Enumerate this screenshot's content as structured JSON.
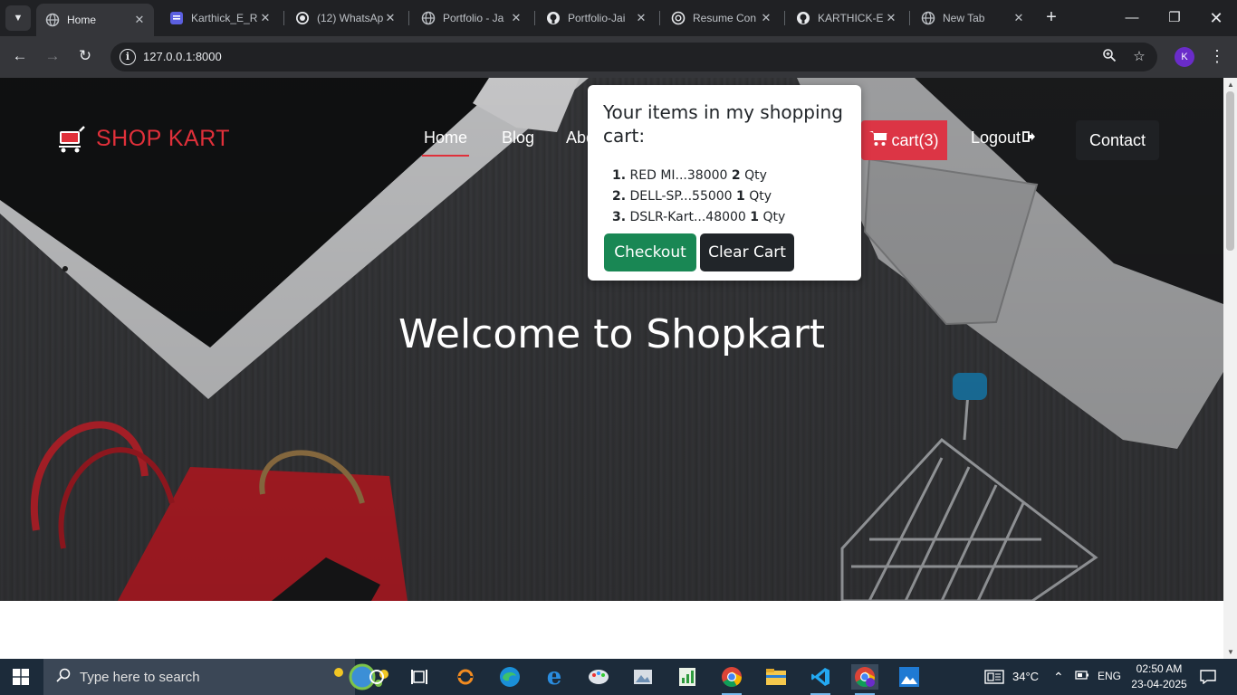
{
  "browser": {
    "tabs": [
      {
        "title": "Home",
        "active": true,
        "favicon": "globe-icon"
      },
      {
        "title": "Karthick_E_R",
        "favicon": "document-icon"
      },
      {
        "title": "(12) WhatsAp",
        "favicon": "whatsapp-icon"
      },
      {
        "title": "Portfolio - Ja",
        "favicon": "globe-icon"
      },
      {
        "title": "Portfolio-Jai",
        "favicon": "github-icon"
      },
      {
        "title": "Resume Con",
        "favicon": "chatgpt-icon"
      },
      {
        "title": "KARTHICK-E",
        "favicon": "github-icon"
      },
      {
        "title": "New Tab",
        "favicon": "chrome-icon"
      }
    ],
    "url": "127.0.0.1:8000",
    "profile_initial": "K"
  },
  "site": {
    "brand": "SHOP KART",
    "nav": {
      "home": "Home",
      "blog": "Blog",
      "about": "Abo",
      "cart": "cart(3)",
      "logout": "Logout",
      "contact": "Contact"
    },
    "hero_title": "Welcome to Shopkart"
  },
  "cart_popover": {
    "title": "Your items in my shopping cart:",
    "items": [
      {
        "num": "1.",
        "name": "RED MI...38000",
        "qty": "2",
        "unit": "Qty"
      },
      {
        "num": "2.",
        "name": "DELL-SP...55000",
        "qty": "1",
        "unit": "Qty"
      },
      {
        "num": "3.",
        "name": "DSLR-Kart...48000",
        "qty": "1",
        "unit": "Qty"
      }
    ],
    "checkout_label": "Checkout",
    "clear_label": "Clear Cart"
  },
  "taskbar": {
    "search_placeholder": "Type here to search",
    "temperature": "34°C",
    "language": "ENG",
    "time": "02:50 AM",
    "date": "23-04-2025"
  },
  "colors": {
    "brand_red": "#e0303a",
    "cart_red": "#dc3545",
    "checkout_green": "#198754",
    "dark_button": "#212529"
  }
}
